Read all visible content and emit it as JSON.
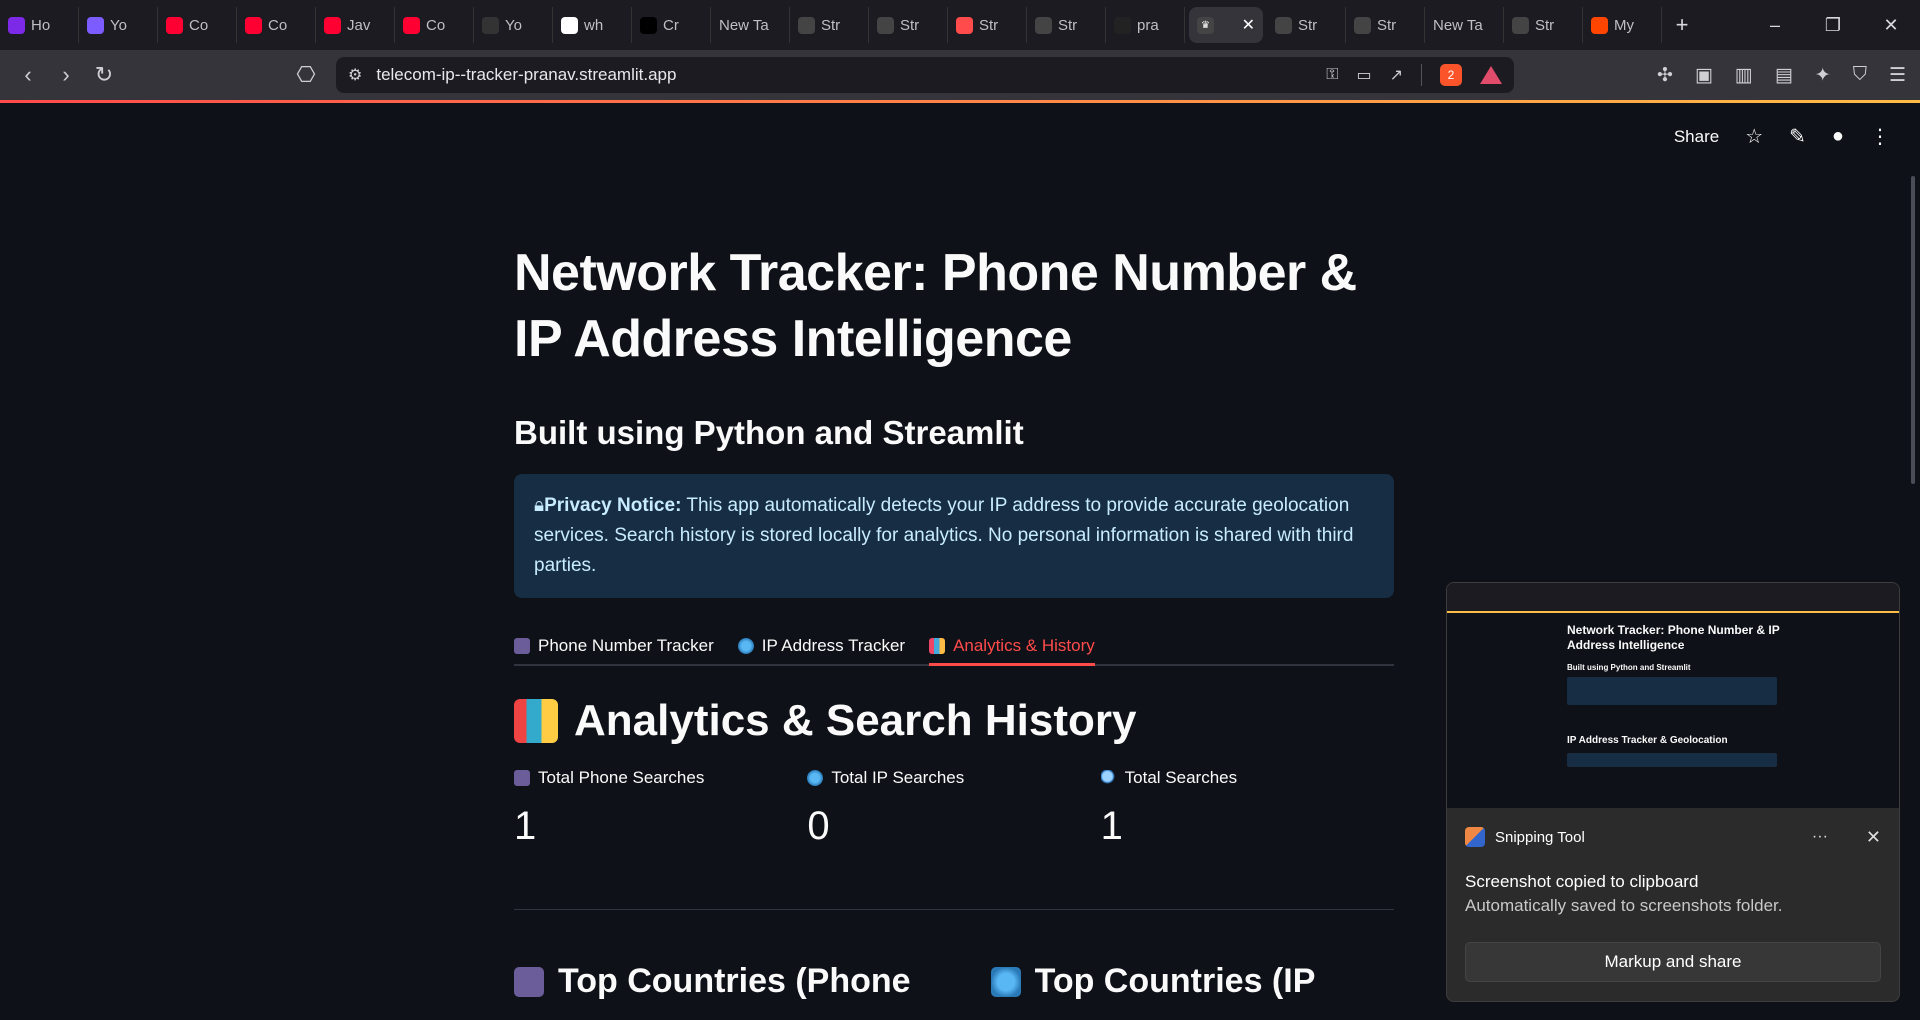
{
  "browser": {
    "tabs": [
      {
        "label": "Ho",
        "favicon": "canva-icon",
        "color": "#7d2ae8"
      },
      {
        "label": "Yo",
        "favicon": "heart-icon",
        "color": "#7c5cff"
      },
      {
        "label": "Co",
        "favicon": "youtube-icon",
        "color": "#ff0033"
      },
      {
        "label": "Co",
        "favicon": "youtube-icon",
        "color": "#ff0033"
      },
      {
        "label": "Jav",
        "favicon": "youtube-icon",
        "color": "#ff0033"
      },
      {
        "label": "Co",
        "favicon": "youtube-icon",
        "color": "#ff0033"
      },
      {
        "label": "Yo",
        "favicon": "chrome-webstore-icon",
        "color": "#333"
      },
      {
        "label": "wh",
        "favicon": "google-icon",
        "color": "#ffffff"
      },
      {
        "label": "Cr",
        "favicon": "triangle-icon",
        "color": "#000"
      },
      {
        "label": "New Ta",
        "favicon": "",
        "color": ""
      },
      {
        "label": "Str",
        "favicon": "streamlit-icon",
        "color": "#444"
      },
      {
        "label": "Str",
        "favicon": "streamlit-icon",
        "color": "#444"
      },
      {
        "label": "Str",
        "favicon": "streamlit-red-icon",
        "color": "#ff4b4b"
      },
      {
        "label": "Str",
        "favicon": "streamlit-icon",
        "color": "#444"
      },
      {
        "label": "pra",
        "favicon": "github-icon",
        "color": "#222"
      }
    ],
    "active_tab_close": "✕",
    "tabs_after": [
      {
        "label": "Str",
        "favicon": "streamlit-icon",
        "color": "#444"
      },
      {
        "label": "Str",
        "favicon": "streamlit-icon",
        "color": "#444"
      },
      {
        "label": "New Ta",
        "favicon": "",
        "color": ""
      },
      {
        "label": "Str",
        "favicon": "streamlit-icon",
        "color": "#444"
      },
      {
        "label": "My",
        "favicon": "reddit-icon",
        "color": "#ff4500"
      }
    ],
    "url": "telecom-ip--tracker-pranav.streamlit.app",
    "brave_badge": "2"
  },
  "streamlit_toolbar": {
    "share_label": "Share"
  },
  "page": {
    "title": "Network Tracker: Phone Number & IP Address Intelligence",
    "subtitle": "Built using Python and Streamlit",
    "notice_bold": "Privacy Notice:",
    "notice_text": " This app automatically detects your IP address to provide accurate geolocation services. Search history is stored locally for analytics. No personal information is shared with third parties.",
    "tabs": [
      {
        "label": "Phone Number Tracker",
        "icon": "phone-icon",
        "selected": false
      },
      {
        "label": "IP Address Tracker",
        "icon": "globe-icon",
        "selected": false
      },
      {
        "label": "Analytics & History",
        "icon": "chart-icon",
        "selected": true
      }
    ],
    "section_title": "Analytics & Search History",
    "metrics": [
      {
        "label": "Total Phone Searches",
        "value": "1",
        "icon": "phone-icon"
      },
      {
        "label": "Total IP Searches",
        "value": "0",
        "icon": "globe-icon"
      },
      {
        "label": "Total Searches",
        "value": "1",
        "icon": "magnifier-icon"
      }
    ],
    "subheads": [
      "Top Countries (Phone",
      "Top Countries (IP"
    ]
  },
  "toast": {
    "app_name": "Snipping Tool",
    "more": "···",
    "close": "✕",
    "line1": "Screenshot copied to clipboard",
    "line2": "Automatically saved to screenshots folder.",
    "button": "Markup and share",
    "preview": {
      "title": "Network Tracker: Phone Number & IP Address Intelligence",
      "subtitle": "Built using Python and Streamlit",
      "heading": "IP Address Tracker & Geolocation"
    }
  }
}
